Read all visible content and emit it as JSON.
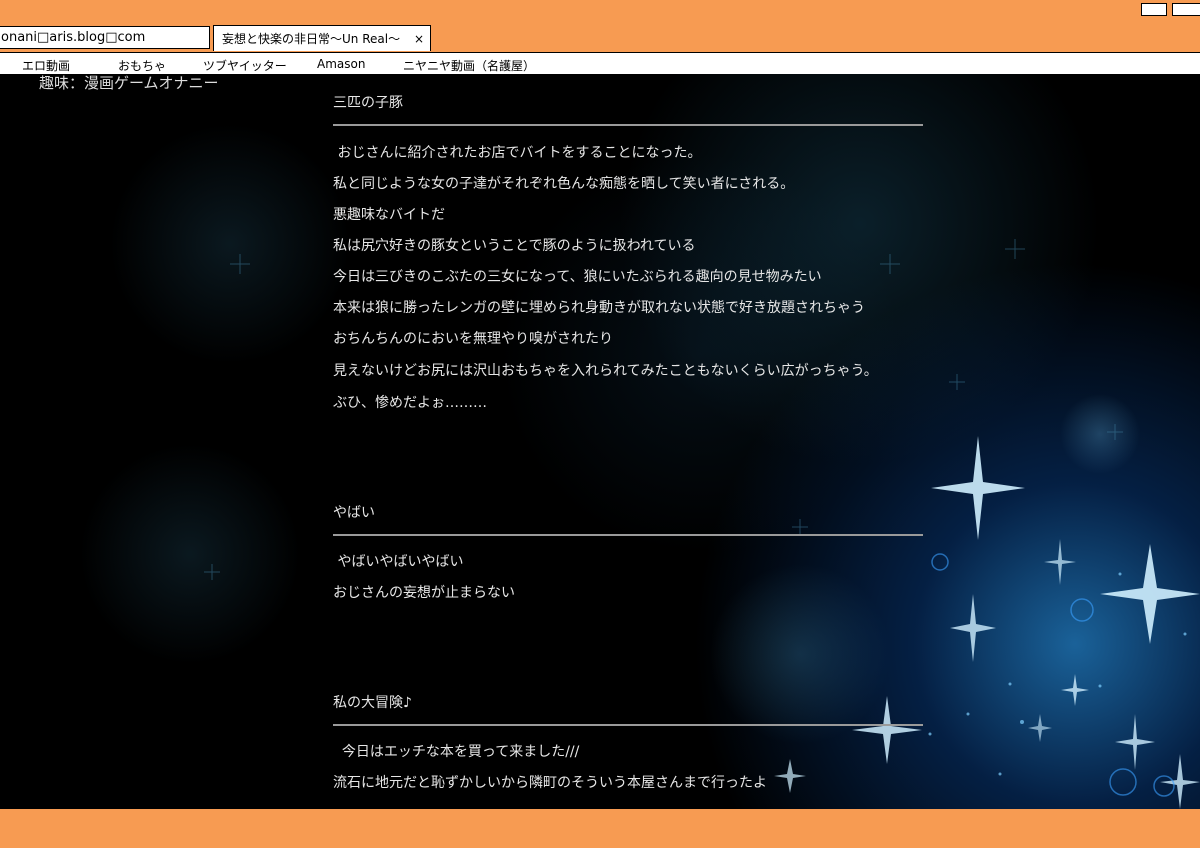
{
  "browser": {
    "url": "onani□aris.blog□com",
    "tab_title": "妄想と快楽の非日常〜Un Real〜",
    "tab_close": "×"
  },
  "menu": [
    {
      "label": "エロ動画"
    },
    {
      "label": "おもちゃ"
    },
    {
      "label": "ツブヤイッター"
    },
    {
      "label": "Amason"
    },
    {
      "label": "ニヤニヤ動画（名護屋）"
    }
  ],
  "profile": {
    "hobby": "趣味：漫画ゲームオナニー"
  },
  "posts": [
    {
      "title": "三匹の子豚",
      "lines": [
        " おじさんに紹介されたお店でバイトをすることになった。",
        "私と同じような女の子達がそれぞれ色んな痴態を晒して笑い者にされる。",
        "悪趣味なバイトだ",
        "私は尻穴好きの豚女ということで豚のように扱われている",
        "今日は三びきのこぶたの三女になって、狼にいたぶられる趣向の見せ物みたい",
        "本来は狼に勝ったレンガの壁に埋められ身動きが取れない状態で好き放題されちゃう",
        "おちんちんのにおいを無理やり嗅がされたり",
        "見えないけどお尻には沢山おもちゃを入れられてみたこともないくらい広がっちゃう。",
        "ぶひ、惨めだよぉ………"
      ]
    },
    {
      "title": "やばい",
      "lines": [
        " やばいやばいやばい",
        "おじさんの妄想が止まらない"
      ]
    },
    {
      "title": "私の大冒険♪",
      "lines": [
        "  今日はエッチな本を買って来ました///",
        "流石に地元だと恥ずかしいから隣町のそういう本屋さんまで行ったよ"
      ]
    }
  ],
  "colors": {
    "frame": "#f79b52",
    "text": "#e6e6e6",
    "rule": "#9a9a9a",
    "sparkle": "#2f9dff"
  }
}
